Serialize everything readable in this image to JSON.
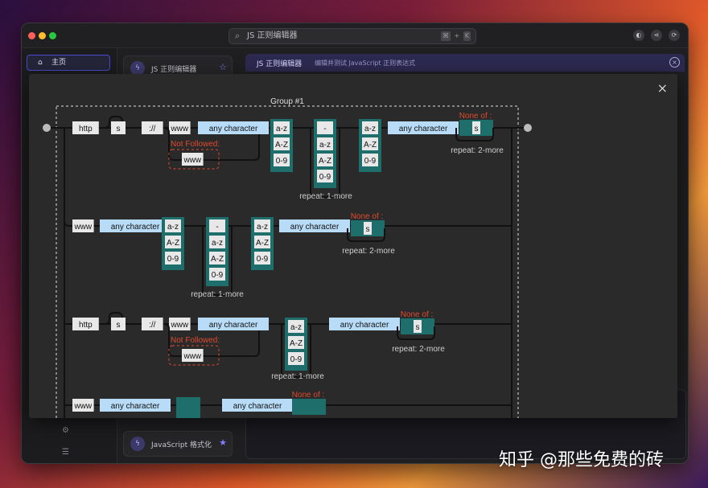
{
  "titlebar": {
    "search_text": "JS 正则编辑器",
    "shortcut_keys": [
      "⌘",
      "+",
      "K"
    ],
    "icons": [
      "wechat-icon",
      "share-icon",
      "sync-icon"
    ]
  },
  "sidebar": {
    "home_label": "主页",
    "home_icon": "home-icon",
    "bottom_icons": [
      "settings-icon",
      "list-icon"
    ]
  },
  "cards": [
    {
      "label": "JS 正则编辑器",
      "icon": "tool-icon",
      "star": "☆"
    },
    {
      "label": "JavaScript 格式化",
      "icon": "tool-icon",
      "star": "★"
    }
  ],
  "tab": {
    "title": "JS 正则编辑器",
    "description": "编辑并测试 JavaScript 正则表达式"
  },
  "modal": {
    "group_label": "Group #1",
    "rows": [
      {
        "prefix": [
          [
            "http"
          ],
          [
            "s"
          ],
          [
            "://"
          ]
        ],
        "not_followed_label": "Not Followed:",
        "not_followed_value": "www",
        "www": "www",
        "any1": "any character",
        "set1": [
          "a-z",
          "A-Z",
          "0-9"
        ],
        "set2": [
          "-",
          "a-z",
          "A-Z",
          "0-9"
        ],
        "set2_repeat": "repeat: 1-more",
        "set3": [
          "a-z",
          "A-Z",
          "0-9"
        ],
        "any2": "any character",
        "none_of_label": "None of :",
        "none_of_value": "s",
        "none_of_repeat": "repeat: 2-more"
      },
      {
        "www": "www",
        "any1": "any character",
        "set1": [
          "a-z",
          "A-Z",
          "0-9"
        ],
        "set2": [
          "-",
          "a-z",
          "A-Z",
          "0-9"
        ],
        "set2_repeat": "repeat: 1-more",
        "set3": [
          "a-z",
          "A-Z",
          "0-9"
        ],
        "any2": "any character",
        "none_of_label": "None of :",
        "none_of_value": "s",
        "none_of_repeat": "repeat: 2-more"
      },
      {
        "prefix": [
          [
            "http"
          ],
          [
            "s"
          ],
          [
            "://"
          ]
        ],
        "not_followed_label": "Not Followed:",
        "not_followed_value": "www",
        "www": "www",
        "any1": "any character",
        "set1": [
          "a-z",
          "A-Z",
          "0-9"
        ],
        "set1_repeat": "repeat: 1-more",
        "any2": "any character",
        "none_of_label": "None of :",
        "none_of_value": "s",
        "none_of_repeat": "repeat: 2-more"
      },
      {
        "www": "www",
        "any1": "any character",
        "any2": "any character",
        "none_of_label": "None of :"
      }
    ],
    "close_icon": "×"
  },
  "watermark": "知乎 @那些免费的砖"
}
